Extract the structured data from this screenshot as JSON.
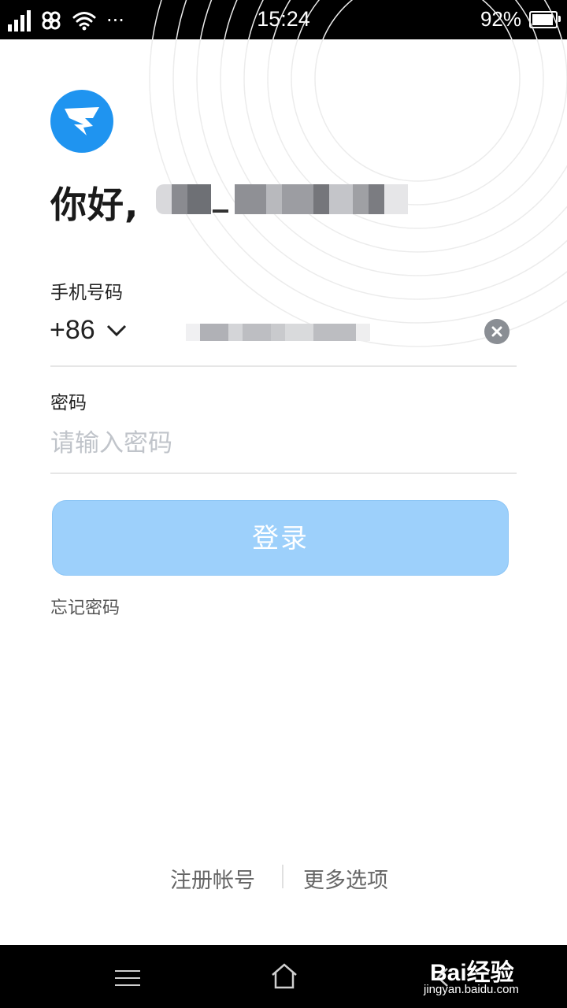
{
  "status_bar": {
    "time": "15:24",
    "battery_text": "92%",
    "battery_level": 0.92,
    "icons": [
      "signal-icon",
      "unicom-icon",
      "wifi-icon",
      "more-dots-icon",
      "battery-icon"
    ]
  },
  "app": {
    "logo_icon": "dingtalk-logo-icon",
    "brand_color": "#1f94f0",
    "greeting": "你好,"
  },
  "phone": {
    "label": "手机号码",
    "country_code": "+86"
  },
  "password": {
    "label": "密码",
    "placeholder": "请输入密码"
  },
  "login_button": {
    "label": "登录",
    "color": "#9dd0fb"
  },
  "forgot_password": "忘记密码",
  "footer": {
    "register": "注册帐号",
    "more_options": "更多选项"
  },
  "nav_bar": {
    "icons": [
      "menu-icon",
      "home-icon",
      "back-icon"
    ]
  },
  "watermark": {
    "main": "Bai经验",
    "sub": "jingyan.baidu.com"
  }
}
